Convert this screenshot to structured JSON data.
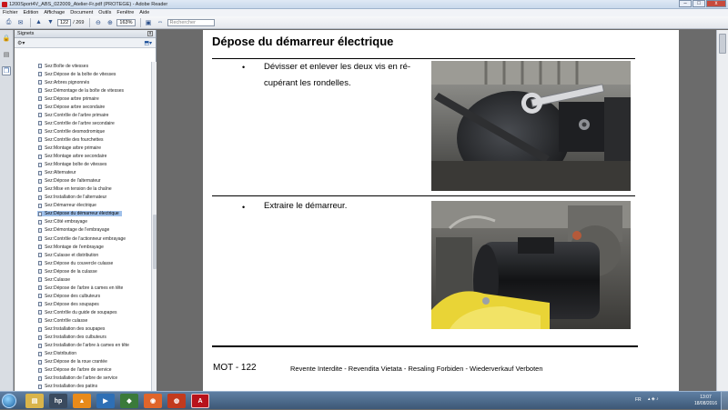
{
  "window": {
    "title": "1200Sport4V_ABS_022009_Atelier-Fr.pdf (PROTEGE) - Adobe Reader",
    "buttons": {
      "minimize": "–",
      "maximize": "□",
      "close": "x"
    }
  },
  "menu": [
    "Fichier",
    "Edition",
    "Affichage",
    "Document",
    "Outils",
    "Fenêtre",
    "Aide"
  ],
  "toolbar": {
    "current_page": "122",
    "page_total": "/ 269",
    "zoom": "163%",
    "search_placeholder": "Rechercher"
  },
  "panel": {
    "title": "Signets",
    "close": "x",
    "bookmarks": [
      "Sez:Boîte de vitesses",
      "Sez:Dépose de la boîte de vitesses",
      "Sez:Arbres pignonnés",
      "Sez:Démontage de la boîte de vitesses",
      "Sez:Dépose arbre primaire",
      "Sez:Dépose arbre secondaire",
      "Sez:Contrôle de l'arbre primaire",
      "Sez:Contrôle de l'arbre secondaire",
      "Sez:Contrôle desmodromique",
      "Sez:Contrôle des fourchettes",
      "Sez:Montage arbre primaire",
      "Sez:Montage arbre secondaire",
      "Sez:Montage boîte de vitesses",
      "Sez:Alternateur",
      "Sez:Dépose de l'alternateur",
      "Sez:Mise en tension de la chaîne",
      "Sez:Installation de l'alternateur",
      "Sez:Démarreur électrique",
      "Sez:Dépose du démarreur électrique",
      "Sez:Côté embrayage",
      "Sez:Démontage de l'embrayage",
      "Sez:Contrôle de l'actionneur embrayage",
      "Sez:Montage de l'embrayage",
      "Sez:Culasse et distribution",
      "Sez:Dépose du couvercle culasse",
      "Sez:Dépose de la culasse",
      "Sez:Culasse",
      "Sez:Dépose de l'arbre à cames en tête",
      "Sez:Dépose des culbuteurs",
      "Sez:Dépose des soupapes",
      "Sez:Contrôle du guide de soupapes",
      "Sez:Contrôle culasse",
      "Sez:Installation des soupapes",
      "Sez:Installation des culbuteurs",
      "Sez:Installation de l'arbre à cames en tête",
      "Sez:Distribution",
      "Sez:Dépose de la roue crantée",
      "Sez:Dépose de l'arbre de service",
      "Sez:Installation de l'arbre de service",
      "Sez:Installation des patins"
    ],
    "selected_index": 18
  },
  "page": {
    "heading": "Dépose du démarreur électrique",
    "steps": [
      {
        "bullet": "•",
        "text": "Dévisser et enlever les deux vis en ré-cupérant les rondelles."
      },
      {
        "bullet": "•",
        "text": "Extraire le démarreur."
      }
    ],
    "footer_page": "MOT - 122",
    "footer_notice": "Revente Interdite - Revendita Vietata - Resaling Forbiden - Wiederverkauf Verboten"
  },
  "taskbar": {
    "lang": "FR",
    "time": "13:07",
    "date": "18/08/2016"
  }
}
